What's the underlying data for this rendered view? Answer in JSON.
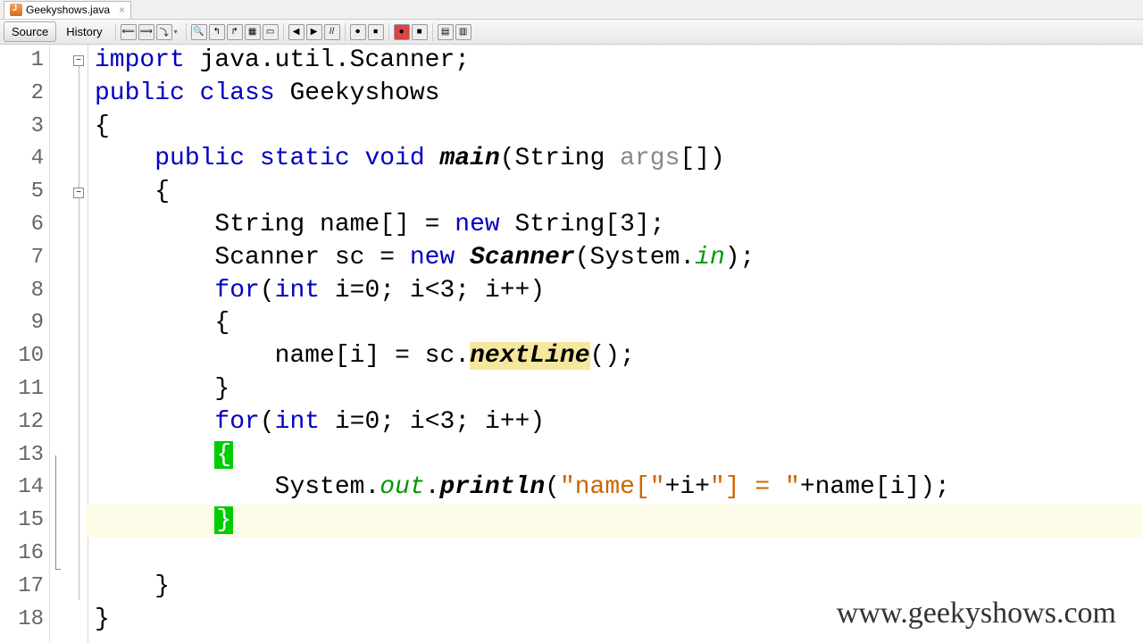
{
  "tab": {
    "filename": "Geekyshows.java"
  },
  "toolbar": {
    "source": "Source",
    "history": "History"
  },
  "lines": [
    "1",
    "2",
    "3",
    "4",
    "5",
    "6",
    "7",
    "8",
    "9",
    "10",
    "11",
    "12",
    "13",
    "14",
    "15",
    "16",
    "17",
    "18"
  ],
  "code": {
    "l1_kw": "import",
    "l1_rest": " java.util.Scanner;",
    "l2_kw1": "public",
    "l2_kw2": "class",
    "l2_name": " Geekyshows",
    "l3": "{",
    "l4_kw1": "public",
    "l4_kw2": "static",
    "l4_kw3": "void",
    "l4_main": "main",
    "l4_sig1": "(String ",
    "l4_args": "args",
    "l4_sig2": "[])",
    "l5": "{",
    "l6_a": "String name[] = ",
    "l6_new": "new",
    "l6_b": " String[",
    "l6_n": "3",
    "l6_c": "];",
    "l7_a": "Scanner sc = ",
    "l7_new": "new",
    "l7_b": " ",
    "l7_scan": "Scanner",
    "l7_c": "(System.",
    "l7_in": "in",
    "l7_d": ");",
    "l8_for": "for",
    "l8_a": "(",
    "l8_int": "int",
    "l8_b": " i=",
    "l8_n0": "0",
    "l8_c": "; i<",
    "l8_n3": "3",
    "l8_d": "; i++)",
    "l9": "{",
    "l10_a": "name[i] = sc.",
    "l10_next": "nextLine",
    "l10_b": "();",
    "l11": "}",
    "l12_for": "for",
    "l12_a": "(",
    "l12_int": "int",
    "l12_b": " i=",
    "l12_n0": "0",
    "l12_c": "; i<",
    "l12_n3": "3",
    "l12_d": "; i++)",
    "l13": "{",
    "l14_a": "System.",
    "l14_out": "out",
    "l14_b": ".",
    "l14_pr": "println",
    "l14_c": "(",
    "l14_s1": "\"name[\"",
    "l14_d": "+i+",
    "l14_s2": "\"] = \"",
    "l14_e": "+name[i]);",
    "l15": "}",
    "l17": "}",
    "l18": "}"
  },
  "watermark": "www.geekyshows.com"
}
